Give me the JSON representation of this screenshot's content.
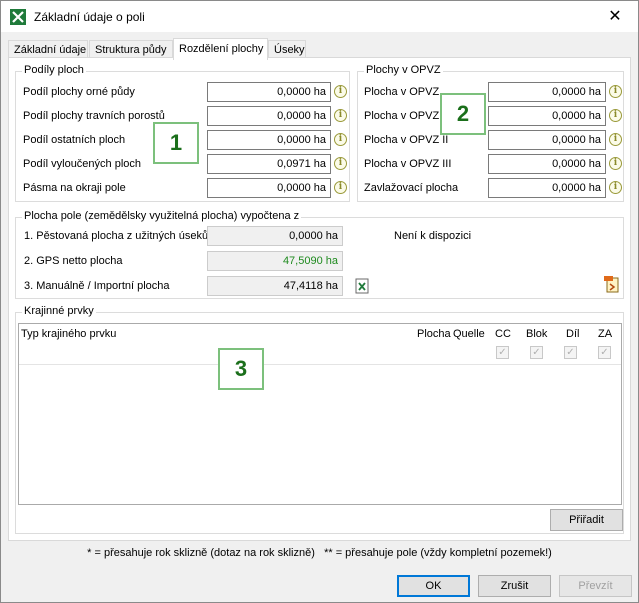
{
  "window": {
    "title": "Základní údaje o poli",
    "close_glyph": "✕"
  },
  "tabs": [
    {
      "label": "Základní údaje"
    },
    {
      "label": "Struktura půdy"
    },
    {
      "label": "Rozdělení plochy"
    },
    {
      "label": "Úseky"
    }
  ],
  "podily": {
    "title": "Podíly ploch",
    "rows": [
      {
        "label": "Podíl plochy orné půdy",
        "value": "0,0000 ha"
      },
      {
        "label": "Podíl plochy travních porostů",
        "value": "0,0000 ha"
      },
      {
        "label": "Podíl ostatních ploch",
        "value": "0,0000 ha"
      },
      {
        "label": "Podíl vyloučených ploch",
        "value": "0,0971 ha"
      },
      {
        "label": "Pásma na okraji pole",
        "value": "0,0000 ha"
      }
    ]
  },
  "opvz": {
    "title": "Plochy v OPVZ",
    "rows": [
      {
        "label": "Plocha v OPVZ",
        "value": "0,0000 ha"
      },
      {
        "label": "Plocha v OPVZ",
        "value": "0,0000 ha"
      },
      {
        "label": "Plocha v OPVZ II",
        "value": "0,0000 ha"
      },
      {
        "label": "Plocha v OPVZ III",
        "value": "0,0000 ha"
      },
      {
        "label": "Zavlažovací plocha",
        "value": "0,0000 ha"
      }
    ]
  },
  "plocha_pole": {
    "title": "Plocha pole (zemědělsky využitelná plocha) vypočtena z",
    "rows": [
      {
        "label": "1. Pěstovaná plocha z užitných úseků",
        "value": "0,0000 ha"
      },
      {
        "label": "2. GPS netto plocha",
        "value": "47,5090 ha"
      },
      {
        "label": "3. Manuálně / Importní plocha",
        "value": "47,4118 ha"
      }
    ],
    "availability": "Není k dispozici"
  },
  "krajinne": {
    "title": "Krajinné prvky",
    "columns": {
      "type": "Typ krajiného prvku",
      "plocha": "Plocha",
      "quelle": "Quelle",
      "cc": "CC",
      "blok": "Blok",
      "dil": "Díl",
      "za": "ZA"
    },
    "assign_label": "Přiřadit"
  },
  "badges": {
    "one": "1",
    "two": "2",
    "three": "3"
  },
  "info_glyph": "i",
  "check_glyph": "✓",
  "footer_note": "* = přesahuje rok sklizně (dotaz na rok sklizně)   ** = přesahuje pole (vždy kompletní pozemek!)",
  "buttons": {
    "ok": "OK",
    "cancel": "Zrušit",
    "adopt": "Převzít"
  },
  "colors": {
    "accent": "#0078d7",
    "badge_green": "#1b6f1b",
    "gps_value_green": "#1e8a1e"
  }
}
